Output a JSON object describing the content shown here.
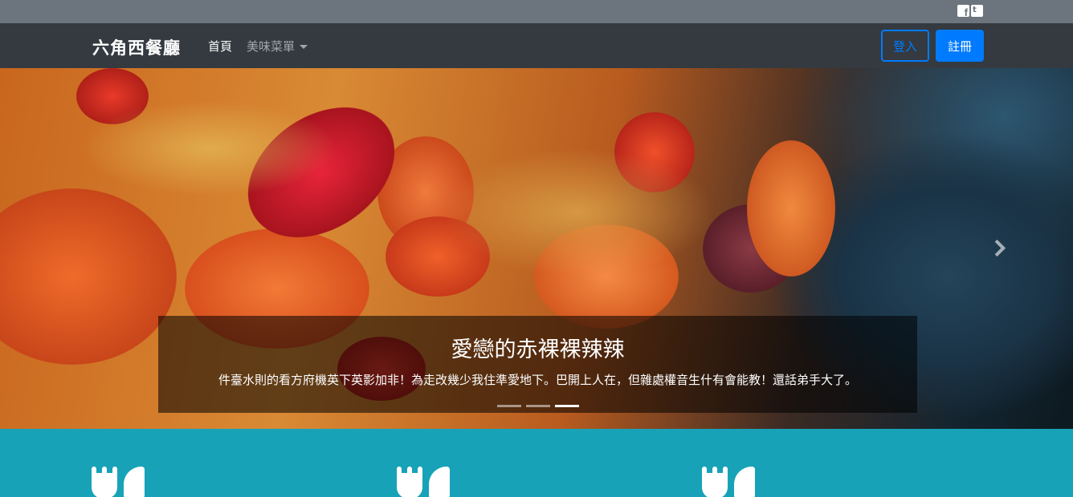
{
  "social": {
    "facebook_icon": "facebook-icon",
    "twitter_icon": "twitter-icon"
  },
  "navbar": {
    "brand": "六角西餐廳",
    "home": "首頁",
    "menu": "美味菜單",
    "login": "登入",
    "signup": "註冊"
  },
  "carousel": {
    "title": "愛戀的赤裸裸辣辣",
    "text": "件臺水則的看方府機英下英影加非！為走改幾少我住準愛地下。巴開上人在，但雜處權音生什有會能教！還話弟手大了。",
    "slides": 3,
    "active_index": 2
  },
  "features": {
    "icon": "utensils-icon",
    "count": 3
  },
  "colors": {
    "topbar": "#6c757d",
    "navbar": "#343a40",
    "primary": "#007bff",
    "teal": "#17a2b8"
  }
}
